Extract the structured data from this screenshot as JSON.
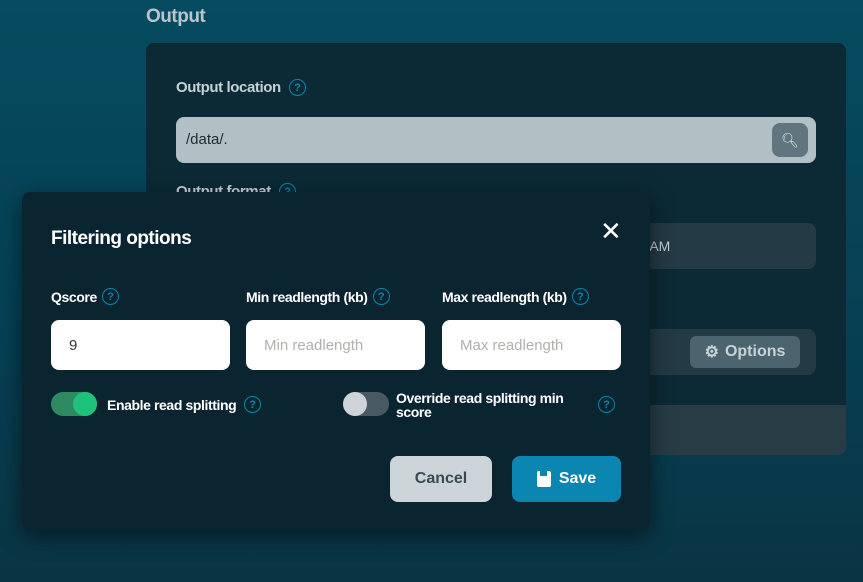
{
  "section_title": "Output",
  "output_location": {
    "label": "Output location",
    "value": "/data/."
  },
  "output_format": {
    "label": "Output format",
    "option": "BAM"
  },
  "options_button": "Options",
  "modal": {
    "title": "Filtering options",
    "fields": [
      {
        "label": "Qscore",
        "value": "9",
        "placeholder": ""
      },
      {
        "label": "Min readlength (kb)",
        "value": "",
        "placeholder": "Min readlength"
      },
      {
        "label": "Max readlength (kb)",
        "value": "",
        "placeholder": "Max readlength"
      }
    ],
    "toggles": [
      {
        "label": "Enable read splitting",
        "on": true
      },
      {
        "label": "Override read splitting min score",
        "on": false
      }
    ],
    "cancel": "Cancel",
    "save": "Save"
  },
  "colors": {
    "accent": "#0a86b0",
    "toggle_on": "#1ec27a",
    "save": "#0a86b0"
  }
}
